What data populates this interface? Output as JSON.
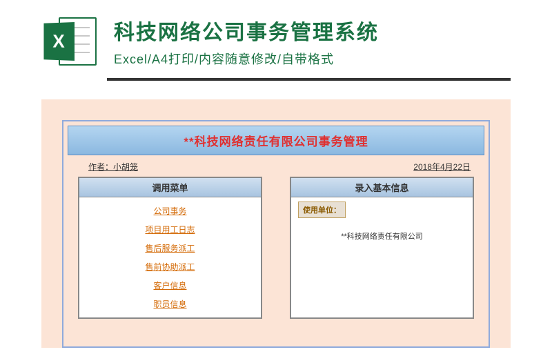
{
  "header": {
    "icon_letter": "X",
    "title": "科技网络公司事务管理系统",
    "subtitle": "Excel/A4打印/内容随意修改/自带格式"
  },
  "document": {
    "title": "**科技网络责任有限公司事务管理",
    "author_label": "作者：小胡笼",
    "date": "2018年4月22日",
    "menu_panel": {
      "header": "调用菜单",
      "items": [
        "公司事务",
        "项目用工日志",
        "售后服务派工",
        "售前协助派工",
        "客户信息",
        "职员信息"
      ]
    },
    "info_panel": {
      "header": "录入基本信息",
      "label": "使用单位：",
      "value": "**科技网络责任有限公司"
    }
  }
}
